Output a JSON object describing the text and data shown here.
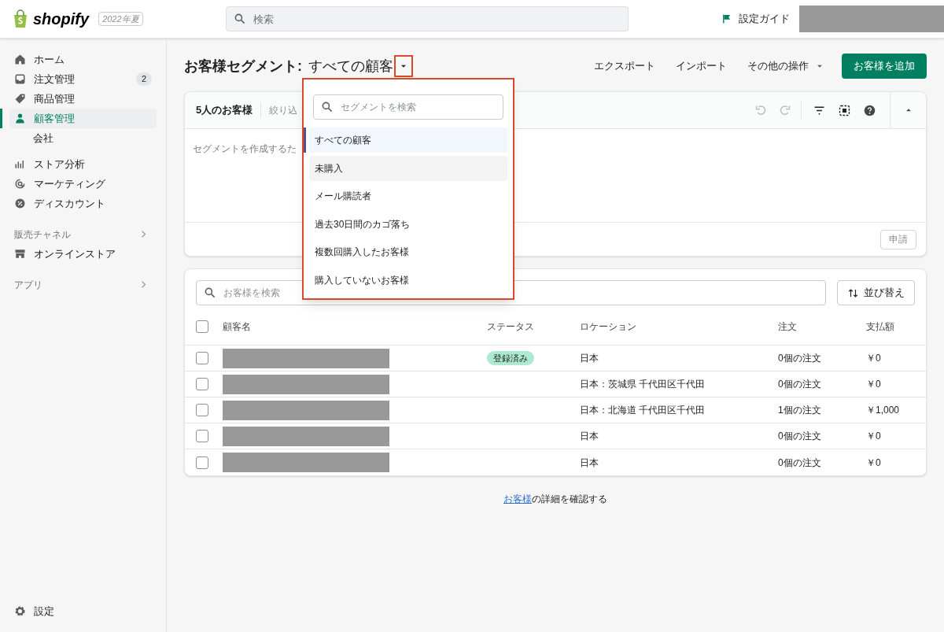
{
  "topbar": {
    "logo": "shopify",
    "edition": "2022年夏",
    "search": {
      "placeholder": "検索"
    },
    "guide": "設定ガイド"
  },
  "sidebar": {
    "items": [
      {
        "label": "ホーム",
        "selected": false
      },
      {
        "label": "注文管理",
        "selected": false,
        "badge": "2"
      },
      {
        "label": "商品管理",
        "selected": false
      },
      {
        "label": "顧客管理",
        "selected": true,
        "children": [
          {
            "label": "会社",
            "selected": false
          }
        ]
      },
      {
        "label": "ストア分析",
        "selected": false
      },
      {
        "label": "マーケティング",
        "selected": false
      },
      {
        "label": "ディスカウント",
        "selected": false
      }
    ],
    "sections": [
      {
        "label": "販売チャネル",
        "items": [
          {
            "label": "オンラインストア",
            "selected": false
          }
        ]
      },
      {
        "label": "アプリ"
      }
    ],
    "settings": "設定"
  },
  "header": {
    "title": "お客様セグメント:",
    "segment": "すべての顧客",
    "actions": [
      "エクスポート",
      "インポート"
    ],
    "more": "その他の操作",
    "primary": "お客様を追加"
  },
  "segment_card": {
    "count": "5人のお客様",
    "filter": "絞り込",
    "hint": "セグメントを作成するた",
    "apply": "申請"
  },
  "dropdown": {
    "search": {
      "placeholder": "セグメントを検索"
    },
    "items": [
      {
        "label": "すべての顧客",
        "selected": true,
        "hovered": false
      },
      {
        "label": "未購入",
        "selected": false,
        "hovered": true
      },
      {
        "label": "メール購読者",
        "selected": false,
        "hovered": false
      },
      {
        "label": "過去30日間のカゴ落ち",
        "selected": false,
        "hovered": false
      },
      {
        "label": "複数回購入したお客様",
        "selected": false,
        "hovered": false
      },
      {
        "label": "購入していないお客様",
        "selected": false,
        "hovered": false
      }
    ]
  },
  "customers": {
    "search": {
      "placeholder": "お客様を検索"
    },
    "sort": "並び替え",
    "select_all": {
      "checked": false
    },
    "columns": [
      "顧客名",
      "ステータス",
      "ロケーション",
      "注文",
      "支払額"
    ],
    "rows": [
      {
        "checked": false,
        "status": "登録済み",
        "location": "日本",
        "orders": "0個の注文",
        "spent": "￥0"
      },
      {
        "checked": false,
        "location": "日本：茨城県 千代田区千代田",
        "orders": "0個の注文",
        "spent": "￥0"
      },
      {
        "checked": false,
        "location": "日本：北海道 千代田区千代田",
        "orders": "1個の注文",
        "spent": "￥1,000"
      },
      {
        "checked": false,
        "location": "日本",
        "orders": "0個の注文",
        "spent": "￥0"
      },
      {
        "checked": false,
        "location": "日本",
        "orders": "0個の注文",
        "spent": "￥0"
      }
    ]
  },
  "footer": {
    "link": "お客様",
    "text": "の詳細を確認する"
  }
}
